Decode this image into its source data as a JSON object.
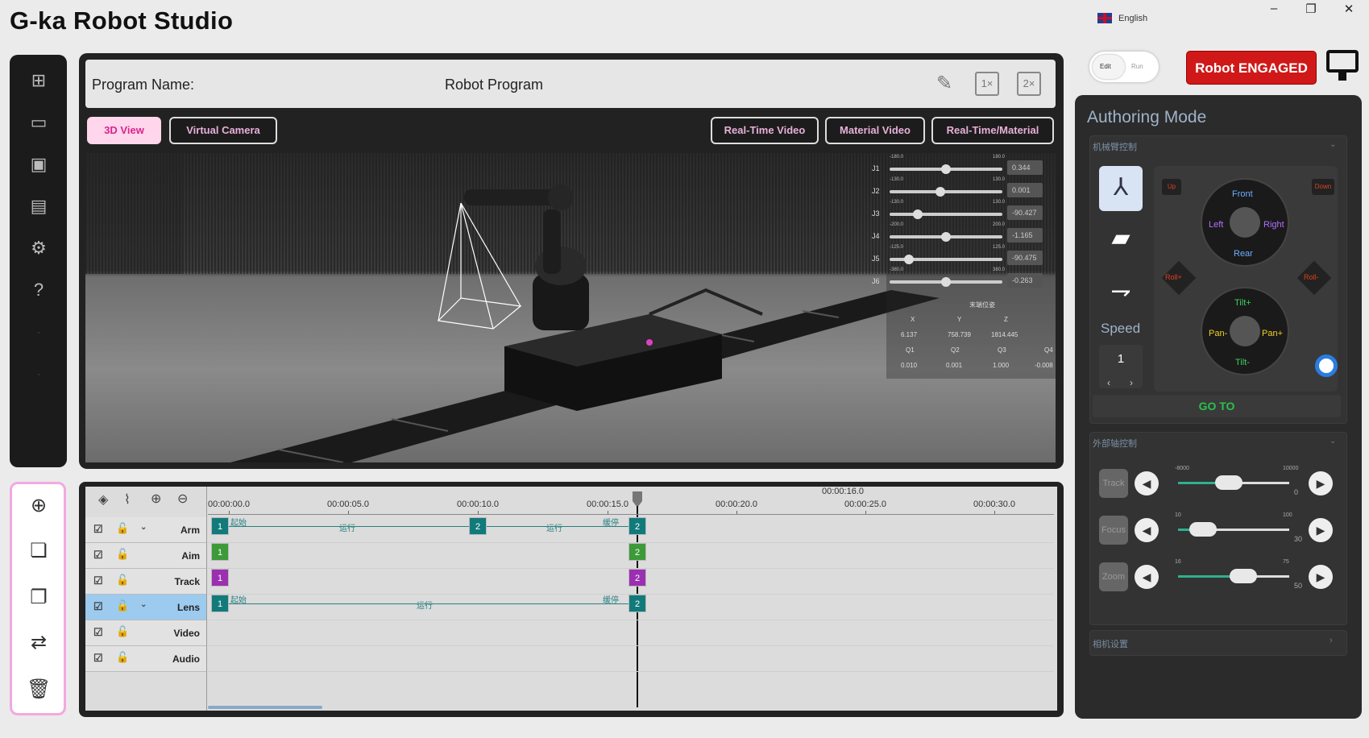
{
  "app": {
    "title": "G-ka Robot Studio",
    "language": "English"
  },
  "window": {
    "minimize": "–",
    "restore": "❐",
    "close": "✕"
  },
  "program": {
    "label": "Program Name:",
    "name": "Robot Program",
    "zoom1": "1×",
    "zoom2": "2×"
  },
  "view_tabs": [
    "3D View",
    "Virtual Camera"
  ],
  "video_tabs": [
    "Real-Time Video",
    "Material Video",
    "Real-Time/Material"
  ],
  "joints": [
    {
      "name": "J1",
      "min": "-180.0",
      "max": "180.0",
      "value": "0.344",
      "pos": 0.5
    },
    {
      "name": "J2",
      "min": "-130.0",
      "max": "130.0",
      "value": "0.001",
      "pos": 0.45
    },
    {
      "name": "J3",
      "min": "-130.0",
      "max": "130.0",
      "value": "-90.427",
      "pos": 0.25
    },
    {
      "name": "J4",
      "min": "-200.0",
      "max": "200.0",
      "value": "-1.165",
      "pos": 0.5
    },
    {
      "name": "J5",
      "min": "-125.0",
      "max": "125.0",
      "value": "-90.475",
      "pos": 0.17
    },
    {
      "name": "J6",
      "min": "-380.0",
      "max": "380.0",
      "value": "-0.263",
      "pos": 0.5
    }
  ],
  "end_pose": {
    "title": "末端位姿",
    "headers": [
      "X",
      "Y",
      "Z"
    ],
    "values": [
      "6.137",
      "758.739",
      "1814.445"
    ],
    "q_headers": [
      "Q1",
      "Q2",
      "Q3",
      "Q4"
    ],
    "q_values": [
      "0.010",
      "0.001",
      "1.000",
      "-0.008"
    ]
  },
  "timeline": {
    "ticks": [
      "00:00:00.0",
      "00:00:05.0",
      "00:00:10.0",
      "00:00:15.0",
      "00:00:20.0",
      "00:00:25.0",
      "00:00:30.0"
    ],
    "playhead": "00:00:16.0",
    "tracks": [
      "Arm",
      "Aim",
      "Track",
      "Lens",
      "Video",
      "Audio"
    ],
    "selected_track": "Lens",
    "segment_start": "起始",
    "segment_run": "运行",
    "segment_slow": "缓停",
    "kf1": "1",
    "kf2": "2"
  },
  "mode_toggle": {
    "edit": "Edit",
    "run": "Run"
  },
  "status": {
    "engaged": "Robot ENGAGED"
  },
  "authoring": {
    "title": "Authoring Mode",
    "arm_section": "机械臂控制",
    "up": "Up",
    "down": "Down",
    "front": "Front",
    "rear": "Rear",
    "left": "Left",
    "right": "Right",
    "roll_plus": "Roll+",
    "roll_minus": "Roll-",
    "tilt_plus": "Tilt+",
    "tilt_minus": "Tilt-",
    "pan_plus": "Pan+",
    "pan_minus": "Pan-",
    "speed_label": "Speed",
    "speed_value": "1",
    "goto": "GO TO",
    "ext_section": "外部轴控制",
    "ext": [
      {
        "label": "Track",
        "min": "-8000",
        "max": "10000",
        "value": "0",
        "pos": 0.45
      },
      {
        "label": "Focus",
        "min": "10",
        "max": "100",
        "value": "30",
        "pos": 0.22
      },
      {
        "label": "Zoom",
        "min": "16",
        "max": "75",
        "value": "50",
        "pos": 0.58
      }
    ],
    "cam_section": "相机设置"
  },
  "colors": {
    "accent_pink": "#d9248f",
    "engaged_red": "#d01818",
    "goto_green": "#27c24c",
    "track_teal": "#127a7a"
  }
}
